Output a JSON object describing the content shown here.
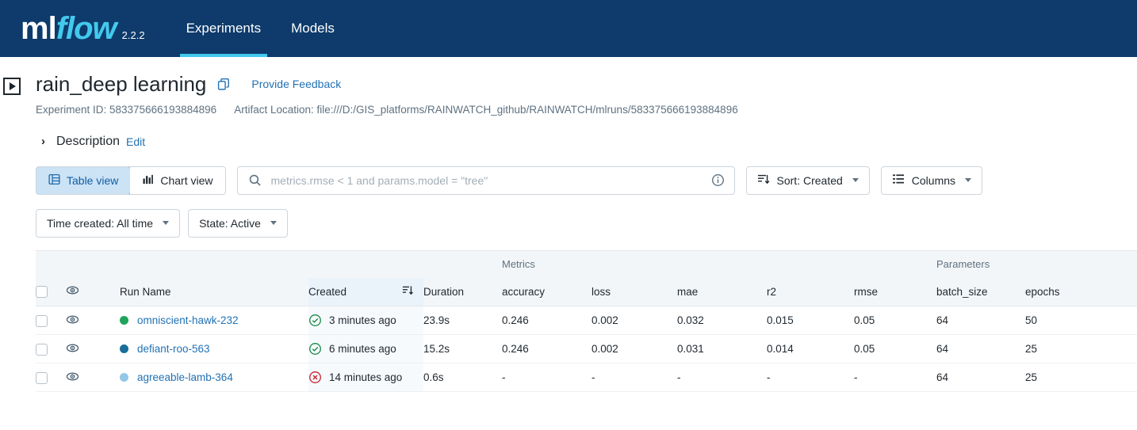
{
  "header": {
    "logo_ml": "ml",
    "logo_flow": "flow",
    "version": "2.2.2",
    "nav": [
      {
        "label": "Experiments",
        "active": true
      },
      {
        "label": "Models",
        "active": false
      }
    ],
    "background": "#0E3B6B",
    "accent": "#43C9ED"
  },
  "experiment": {
    "title": "rain_deep learning",
    "copy_icon": "copy-icon",
    "feedback_link": "Provide Feedback",
    "experiment_id_label": "Experiment ID: 583375666193884896",
    "artifact_location_label": "Artifact Location: file:///D:/GIS_platforms/RAINWATCH_github/RAINWATCH/mlruns/583375666193884896",
    "description_label": "Description",
    "description_edit": "Edit"
  },
  "toolbar": {
    "table_view": "Table view",
    "chart_view": "Chart view",
    "search_placeholder": "metrics.rmse < 1 and params.model = \"tree\"",
    "search_value": "",
    "sort_label": "Sort: Created",
    "columns_label": "Columns",
    "active_view": "Table view"
  },
  "filters": {
    "time_created": "Time created: All time",
    "state": "State: Active"
  },
  "table": {
    "groups": {
      "metrics": "Metrics",
      "parameters": "Parameters"
    },
    "columns": [
      "Run Name",
      "Created",
      "Duration",
      "accuracy",
      "loss",
      "mae",
      "r2",
      "rmse",
      "batch_size",
      "epochs"
    ],
    "sorted_column": "Created",
    "rows": [
      {
        "checked": false,
        "dot_color": "#21A35B",
        "run_name": "omniscient-hawk-232",
        "status": "finished",
        "created": "3 minutes ago",
        "duration": "23.9s",
        "accuracy": "0.246",
        "loss": "0.002",
        "mae": "0.032",
        "r2": "0.015",
        "rmse": "0.05",
        "batch_size": "64",
        "epochs": "50"
      },
      {
        "checked": false,
        "dot_color": "#1A6E9B",
        "run_name": "defiant-roo-563",
        "status": "finished",
        "created": "6 minutes ago",
        "duration": "15.2s",
        "accuracy": "0.246",
        "loss": "0.002",
        "mae": "0.031",
        "r2": "0.014",
        "rmse": "0.05",
        "batch_size": "64",
        "epochs": "25"
      },
      {
        "checked": false,
        "dot_color": "#94C7E8",
        "run_name": "agreeable-lamb-364",
        "status": "failed",
        "created": "14 minutes ago",
        "duration": "0.6s",
        "accuracy": "-",
        "loss": "-",
        "mae": "-",
        "r2": "-",
        "rmse": "-",
        "batch_size": "64",
        "epochs": "25"
      }
    ]
  },
  "colors": {
    "link": "#2272B4",
    "success": "#1B8A4B",
    "error": "#C9252D",
    "muted": "#5F7281"
  }
}
